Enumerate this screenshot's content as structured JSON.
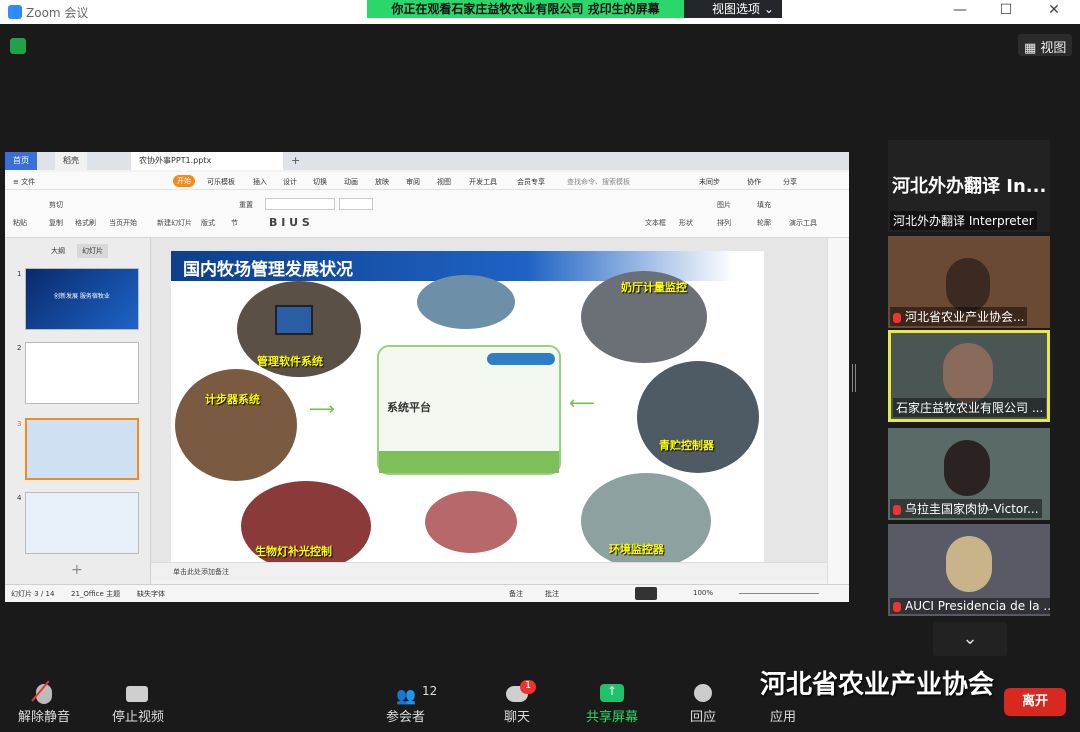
{
  "window": {
    "title": "Zoom 会议",
    "share_banner": "你正在观看石家庄益牧农业有限公司  戎印生的屏幕",
    "view_options": "视图选项 ⌄",
    "view_button": "视图"
  },
  "wps": {
    "tabs": [
      "首页",
      "稻壳",
      "农协外事PPT1.pptx"
    ],
    "menu": [
      "≡ 文件",
      "开始",
      "可乐模板",
      "插入",
      "设计",
      "切换",
      "动画",
      "放映",
      "审阅",
      "视图",
      "开发工具",
      "会员专享",
      "查找命令、搜索模板",
      "未同步",
      "协作",
      "分享"
    ],
    "ribbon": [
      "粘贴",
      "剪切",
      "复制",
      "格式刷",
      "当页开始",
      "新建幻灯片",
      "版式",
      "节",
      "重置",
      "文本框",
      "形状",
      "图片",
      "排列",
      "填充",
      "轮廓",
      "演示工具"
    ],
    "panel_tabs": [
      "大纲",
      "幻灯片"
    ],
    "slide_numbers": [
      "1",
      "2",
      "3",
      "4"
    ],
    "thumb1_text": "创新发展  服务宿牧业",
    "slide_title": "国内牧场管理发展状况",
    "labels": {
      "software": "管理软件系统",
      "pedometer": "计步器系统",
      "light": "生物灯补光控制",
      "platform": "系统平台",
      "milk": "奶厅计量监控",
      "feed": "青贮控制器",
      "env": "环境监控器"
    },
    "notes_placeholder": "单击此处添加备注",
    "status": {
      "slide": "幻灯片 3 / 14",
      "theme": "21_Office 主题",
      "font": "缺失字体",
      "notes": "备注",
      "comment": "批注",
      "zoom": "100%"
    }
  },
  "participants": [
    {
      "name": "河北外办翻译 Interpreter",
      "big": "河北外办翻译 In...",
      "muted": false
    },
    {
      "name": "河北省农业产业协会...",
      "muted": true
    },
    {
      "name": "石家庄益牧农业有限公司 ...",
      "muted": false,
      "active": true
    },
    {
      "name": "乌拉圭国家肉协-Victor...",
      "muted": true
    },
    {
      "name": "AUCI Presidencia de la ...",
      "muted": true
    }
  ],
  "toolbar": {
    "mute": "解除静音",
    "video": "停止视频",
    "participants": "参会者",
    "participants_count": "12",
    "chat": "聊天",
    "chat_badge": "1",
    "share": "共享屏幕",
    "reactions": "回应",
    "apps": "应用",
    "leave": "离开"
  },
  "watermark": "河北省农业产业协会",
  "colors": {
    "share_green": "#2bd66b",
    "leave_red": "#d9281f",
    "active_border": "#e7e84a"
  }
}
